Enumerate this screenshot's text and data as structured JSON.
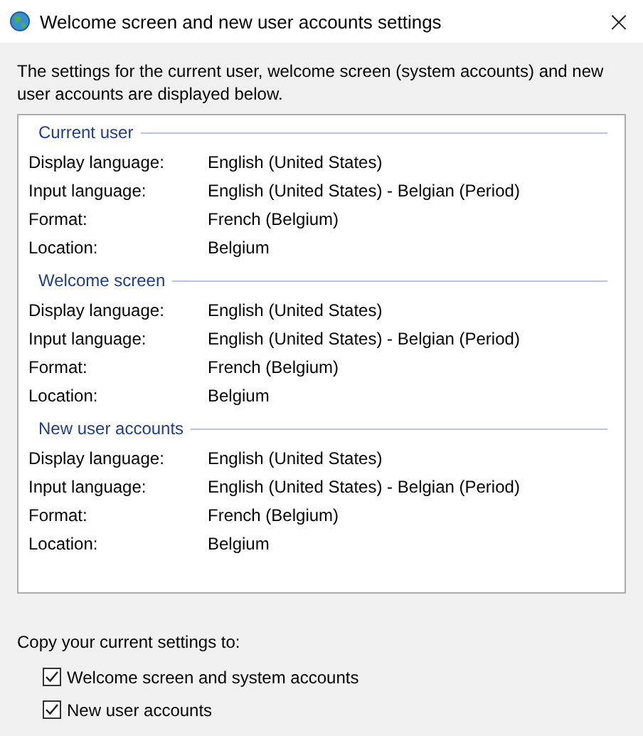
{
  "window": {
    "title": "Welcome screen and new user accounts settings",
    "close": "×"
  },
  "description": "The settings for the current user, welcome screen (system accounts) and new user accounts are displayed below.",
  "sections": [
    {
      "heading": "Current user",
      "rows": [
        {
          "label": "Display language:",
          "value": "English (United States)"
        },
        {
          "label": "Input language:",
          "value": "English (United States) - Belgian (Period)"
        },
        {
          "label": "Format:",
          "value": "French (Belgium)"
        },
        {
          "label": "Location:",
          "value": "Belgium"
        }
      ]
    },
    {
      "heading": "Welcome screen",
      "rows": [
        {
          "label": "Display language:",
          "value": "English (United States)"
        },
        {
          "label": "Input language:",
          "value": "English (United States) - Belgian (Period)"
        },
        {
          "label": "Format:",
          "value": "French (Belgium)"
        },
        {
          "label": "Location:",
          "value": "Belgium"
        }
      ]
    },
    {
      "heading": "New user accounts",
      "rows": [
        {
          "label": "Display language:",
          "value": "English (United States)"
        },
        {
          "label": "Input language:",
          "value": "English (United States) - Belgian (Period)"
        },
        {
          "label": "Format:",
          "value": "French (Belgium)"
        },
        {
          "label": "Location:",
          "value": "Belgium"
        }
      ]
    }
  ],
  "copy": {
    "label": "Copy your current settings to:",
    "options": [
      {
        "label": "Welcome screen and system accounts",
        "checked": true
      },
      {
        "label": "New user accounts",
        "checked": true
      }
    ]
  }
}
